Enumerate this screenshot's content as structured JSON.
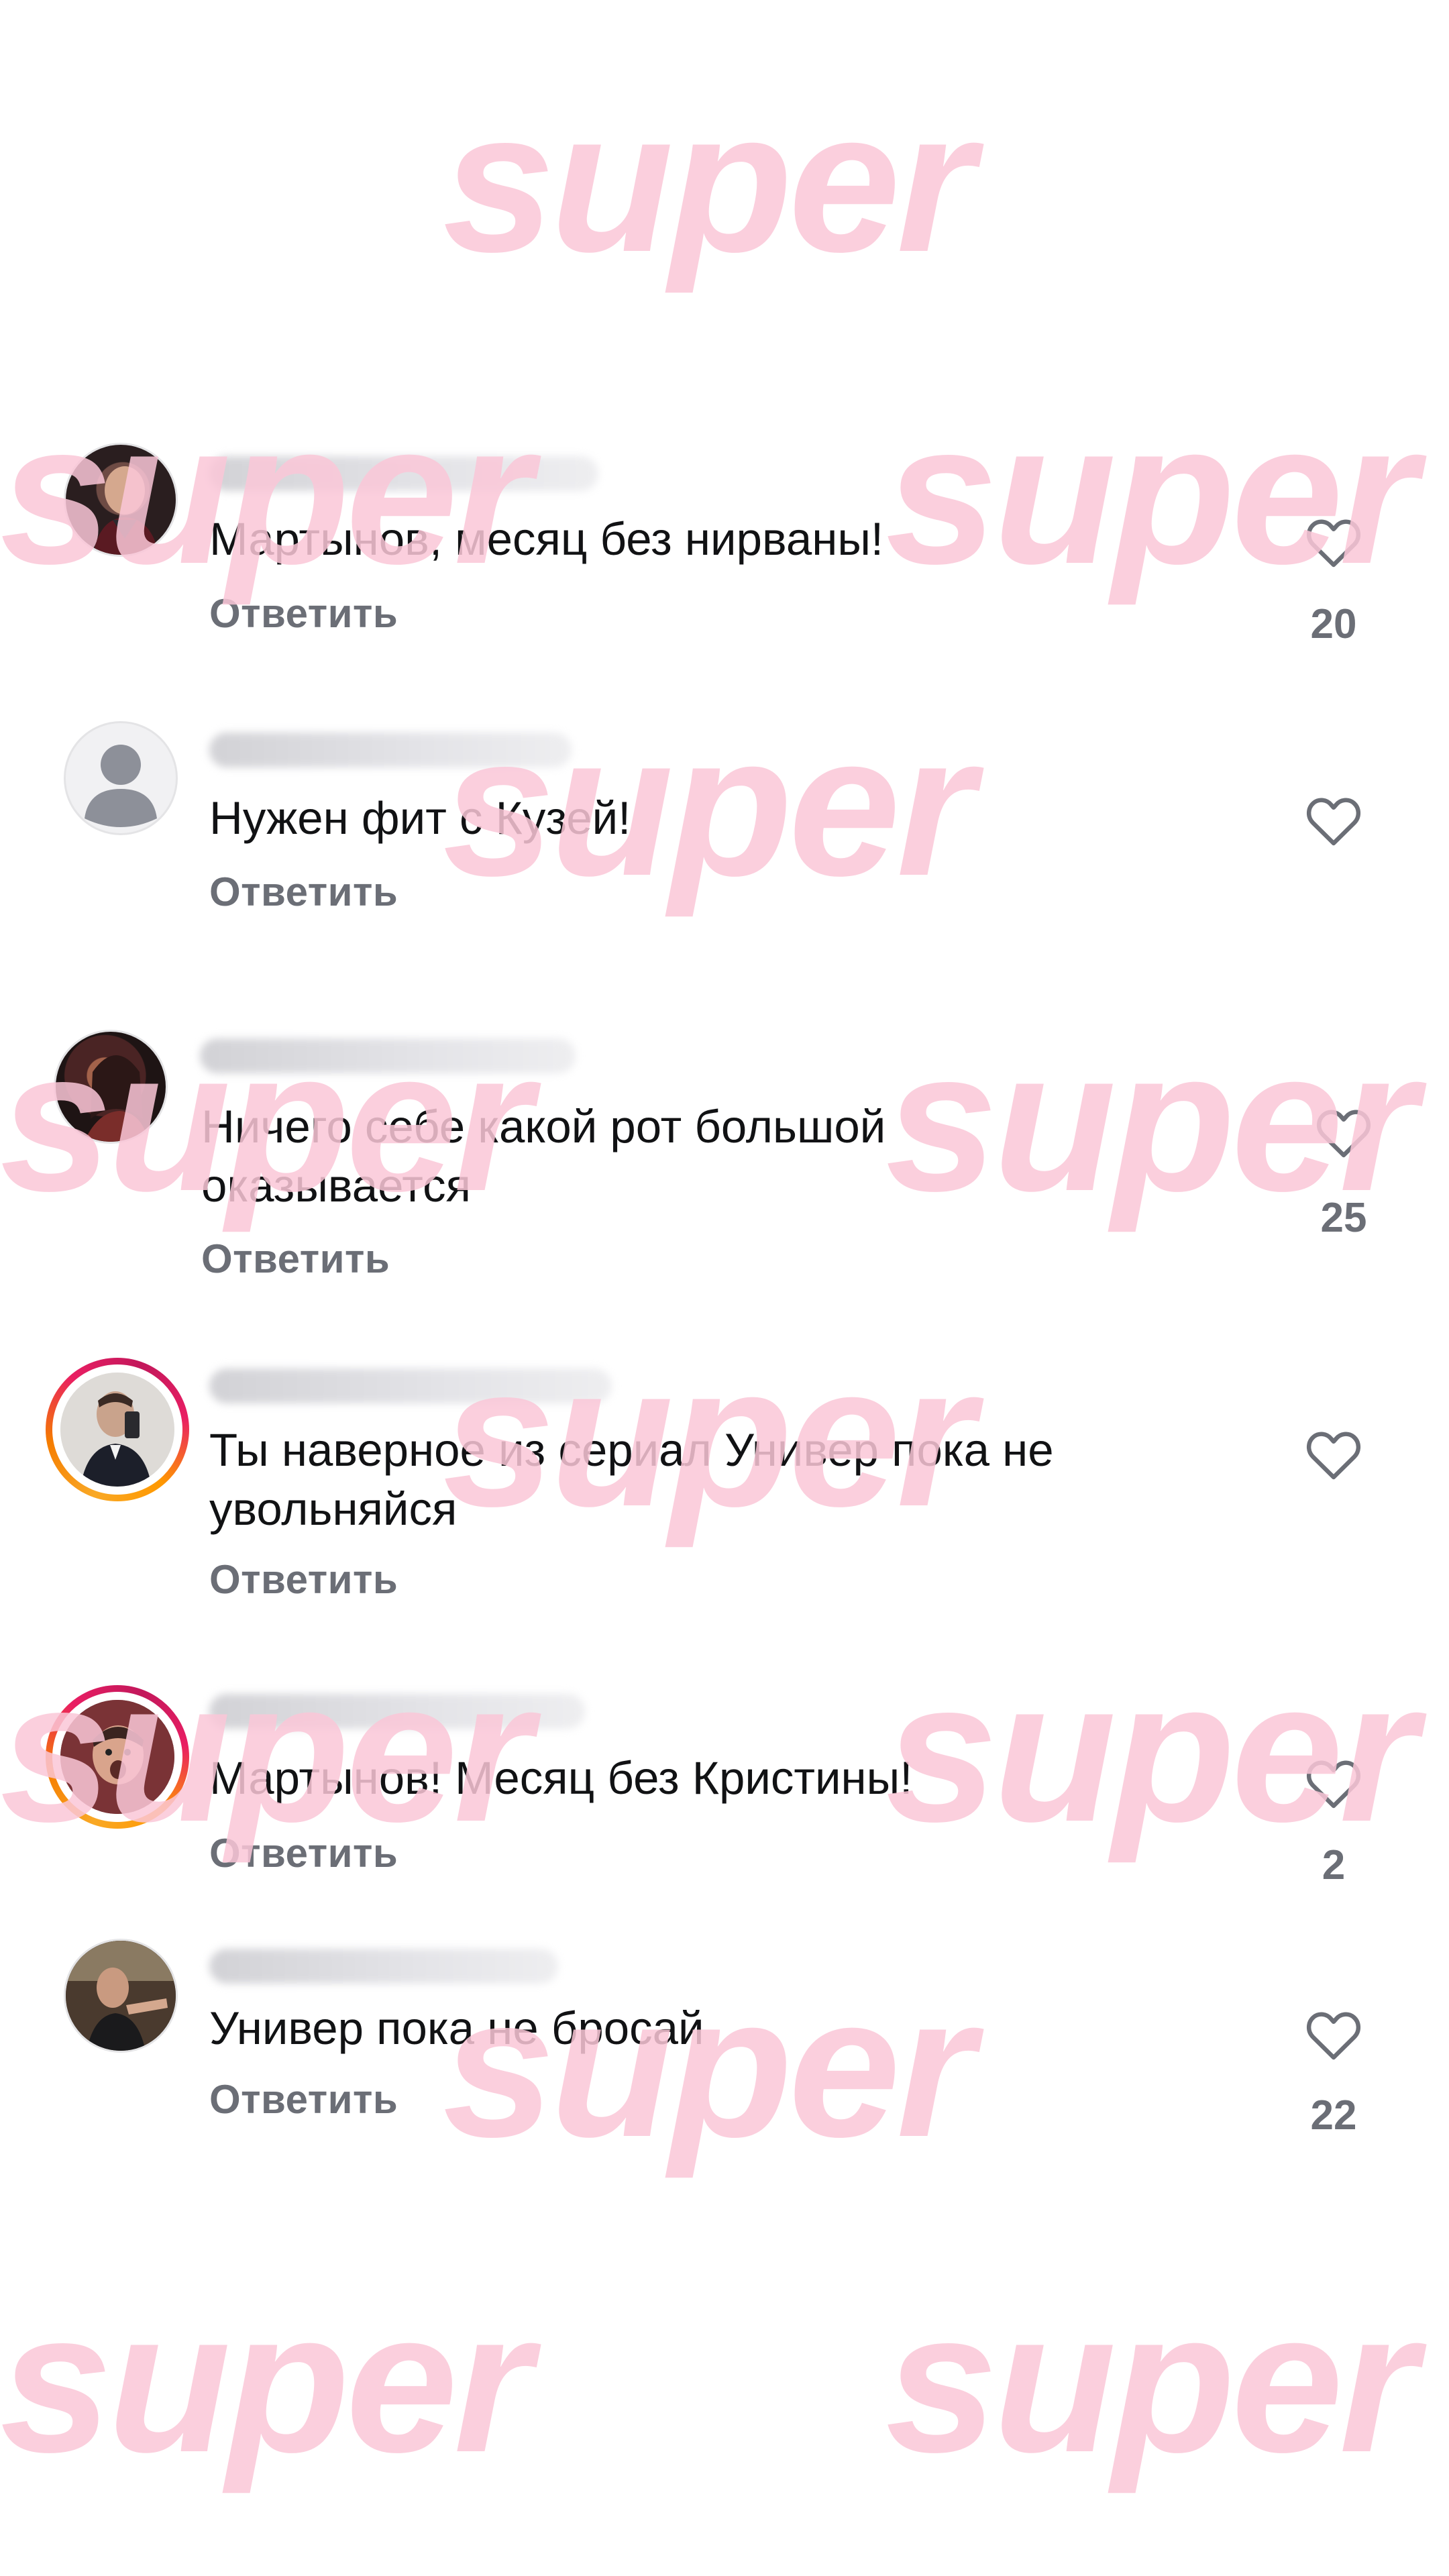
{
  "watermark_text": "super",
  "reply_label": "Ответить",
  "comments": [
    {
      "text": "Мартынов, месяц без нирваны!",
      "likes": "20",
      "avatar": "photo-man-red-sweater"
    },
    {
      "text": "Нужен фит с Кузей!",
      "likes": "",
      "avatar": "default-user-icon"
    },
    {
      "text": "Ничего себе какой рот большой оказывается",
      "likes": "25",
      "avatar": "photo-woman-dark-hair"
    },
    {
      "text": "Ты наверное из сериал Универ пока не увольняйся",
      "likes": "",
      "avatar": "photo-man-mirror-selfie"
    },
    {
      "text": "Мартынов! Месяц без Кристины!",
      "likes": "2",
      "avatar": "photo-man-surprised"
    },
    {
      "text": "Универ пока не бросай",
      "likes": "22",
      "avatar": "photo-man-pointing"
    }
  ],
  "colors": {
    "watermark": "#fbc7d8",
    "secondary_text": "#6b6e76",
    "primary_text": "#111214",
    "story_ring": [
      "#f9a825",
      "#e91e63"
    ]
  }
}
